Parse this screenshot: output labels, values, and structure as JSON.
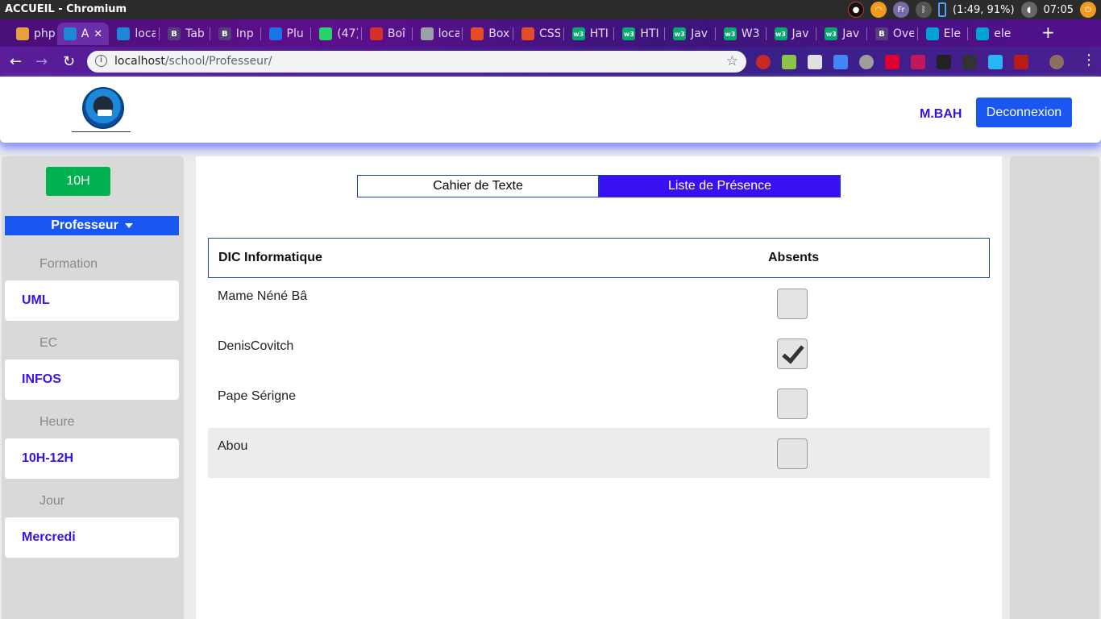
{
  "os": {
    "title": "ACCUEIL - Chromium",
    "lang": "Fr",
    "battery": "(1:49, 91%)",
    "time": "07:05"
  },
  "browser": {
    "tabs": [
      {
        "label": "php",
        "icon": "triangle-icon",
        "color": "#e8a03a"
      },
      {
        "label": "A",
        "icon": "school-logo-icon",
        "color": "#1e88d8",
        "active": true
      },
      {
        "label": "loca",
        "icon": "school-logo-icon",
        "color": "#1e88d8"
      },
      {
        "label": "Tab",
        "icon": "bootstrap-icon",
        "color": "#563d7c"
      },
      {
        "label": "Inp",
        "icon": "bootstrap-icon",
        "color": "#563d7c"
      },
      {
        "label": "Plu",
        "icon": "flag-icon",
        "color": "#1a73e8"
      },
      {
        "label": "(47)",
        "icon": "whatsapp-icon",
        "color": "#25d366"
      },
      {
        "label": "Boî",
        "icon": "gmail-icon",
        "color": "#d93025"
      },
      {
        "label": "loca",
        "icon": "globe-icon",
        "color": "#9aa0a6"
      },
      {
        "label": "Box",
        "icon": "box-icon",
        "color": "#e44d26"
      },
      {
        "label": "CSS",
        "icon": "box-icon",
        "color": "#e44d26"
      },
      {
        "label": "HTI",
        "icon": "w3-icon",
        "color": "#04aa6d"
      },
      {
        "label": "HTI",
        "icon": "w3-icon",
        "color": "#04aa6d"
      },
      {
        "label": "Jav",
        "icon": "w3-icon",
        "color": "#04aa6d"
      },
      {
        "label": "W3",
        "icon": "w3-icon",
        "color": "#04aa6d"
      },
      {
        "label": "Jav",
        "icon": "w3-icon",
        "color": "#04aa6d"
      },
      {
        "label": "Jav",
        "icon": "w3-icon",
        "color": "#04aa6d"
      },
      {
        "label": "Ove",
        "icon": "bootstrap-icon",
        "color": "#563d7c"
      },
      {
        "label": "Ele",
        "icon": "element-icon",
        "color": "#00a2d4"
      },
      {
        "label": "ele",
        "icon": "element-icon",
        "color": "#00a2d4"
      }
    ],
    "url_host": "localhost",
    "url_path": "/school/Professeur/"
  },
  "header": {
    "user": "M.BAH",
    "logout_label": "Deconnexion"
  },
  "sidebar": {
    "time_button": "10H",
    "role": "Professeur",
    "fields": [
      {
        "label": "Formation",
        "value": "UML"
      },
      {
        "label": "EC",
        "value": "INFOS"
      },
      {
        "label": "Heure",
        "value": "10H-12H"
      },
      {
        "label": "Jour",
        "value": "Mercredi"
      }
    ]
  },
  "main": {
    "tabs": [
      {
        "label": "Cahier de Texte",
        "active": false
      },
      {
        "label": "Liste de Présence",
        "active": true
      }
    ],
    "table": {
      "group_header": "DIC Informatique",
      "absent_header": "Absents",
      "rows": [
        {
          "name": "Mame Néné Bâ",
          "absent": false
        },
        {
          "name": "DenisCovitch",
          "absent": true
        },
        {
          "name": "Pape Sérigne",
          "absent": false
        },
        {
          "name": "Abou",
          "absent": false
        }
      ]
    }
  },
  "colors": {
    "accent_blue": "#1a56f0",
    "active_tab": "#3a10f0",
    "link_purple": "#3a10e8",
    "green": "#00b14f"
  }
}
